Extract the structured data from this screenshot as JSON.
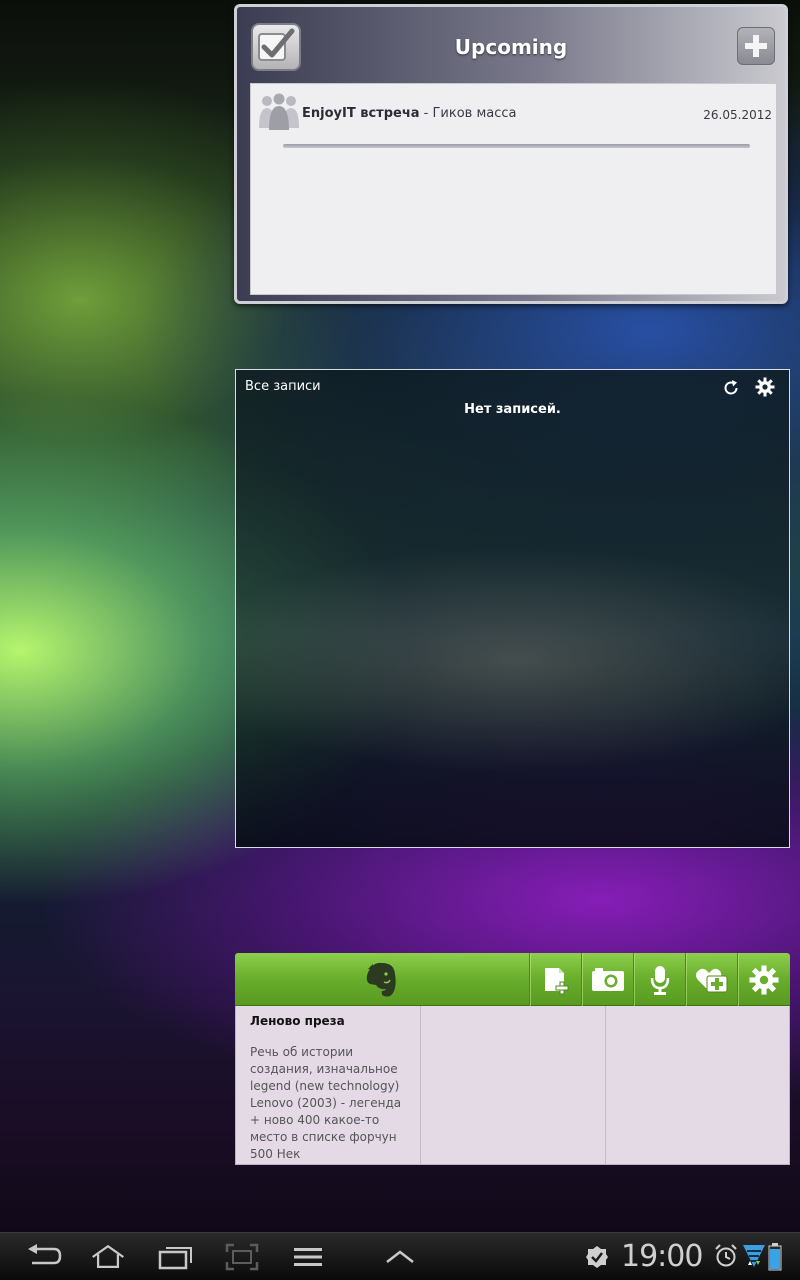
{
  "upcoming": {
    "title": "Upcoming",
    "events": [
      {
        "title": "EnjoyIT встреча",
        "separator": " - ",
        "location": "Гиков масса",
        "date": "26.05.2012"
      }
    ]
  },
  "notes_widget": {
    "heading": "Все записи",
    "empty_text": "Нет записей."
  },
  "evernote": {
    "toolbar_icons": [
      "evernote-elephant-icon",
      "new-note-icon",
      "snapshot-icon",
      "audio-note-icon",
      "add-contact-icon",
      "gear-icon"
    ],
    "accent": "#6aae2d",
    "cards": [
      {
        "title": "Леново преза",
        "body": "Речь об истории создания, изначальное legend (new technology) Lenovo (2003) - легенда + ново 400 какое-то место в списке форчун 500 Нек"
      },
      {
        "title": "",
        "body": ""
      },
      {
        "title": "",
        "body": ""
      }
    ]
  },
  "navbar": {
    "buttons": [
      "back-icon",
      "home-icon",
      "recent-apps-icon",
      "screenshot-icon",
      "menu-icon",
      "up-chevron-icon"
    ],
    "clock": "19:00",
    "status_icons": [
      "notification-check-icon",
      "alarm-icon",
      "wifi-icon",
      "battery-icon"
    ]
  }
}
